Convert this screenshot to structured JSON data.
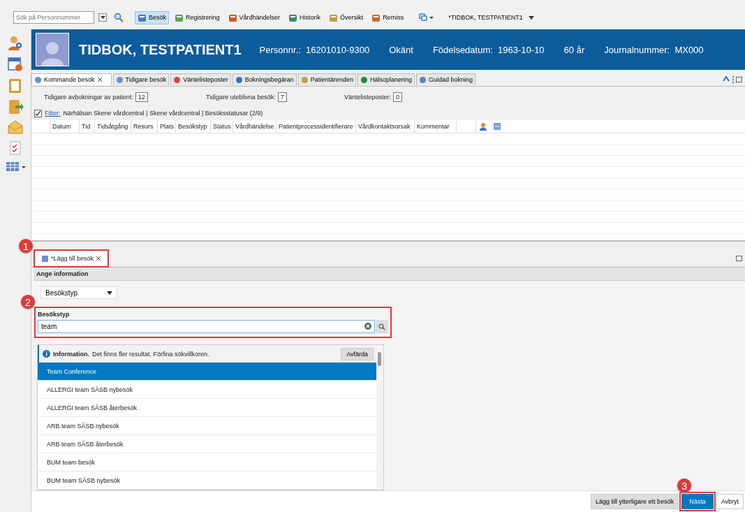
{
  "toolbar": {
    "search_placeholder": "Sök på Personnummer",
    "buttons": [
      {
        "label": "Besök",
        "selected": true
      },
      {
        "label": "Registrering",
        "selected": false
      },
      {
        "label": "Vårdhändelser",
        "selected": false
      },
      {
        "label": "Historik",
        "selected": false
      },
      {
        "label": "Översikt",
        "selected": false
      },
      {
        "label": "Remiss",
        "selected": false
      }
    ],
    "patient_menu": "*TIDBOK, TESTPATIENT1"
  },
  "header": {
    "name": "TIDBOK, TESTPATIENT1",
    "fields": [
      {
        "label": "Personnr.:",
        "value": "16201010-9300"
      },
      {
        "value": "Okänt"
      },
      {
        "label": "Födelsedatum:",
        "value": "1963-10-10"
      },
      {
        "value": "60 år"
      },
      {
        "label": "Journalnummer:",
        "value": "MX000"
      }
    ]
  },
  "tabs": [
    {
      "label": "Kommande besök",
      "selected": true
    },
    {
      "label": "Tidigare besök",
      "selected": false
    },
    {
      "label": "Väntelisteposter",
      "selected": false
    },
    {
      "label": "Bokningsbegäran",
      "selected": false
    },
    {
      "label": "Patientärenden",
      "selected": false
    },
    {
      "label": "Hälsoplanering",
      "selected": false
    },
    {
      "label": "Guidad bokning",
      "selected": false
    }
  ],
  "counters": [
    {
      "label": "Tidigare avbokningar av patient:",
      "value": "12"
    },
    {
      "label": "Tidigare uteblivna besök:",
      "value": "7"
    },
    {
      "label": "Väntelisteposter:",
      "value": "0"
    }
  ],
  "filter": {
    "checked": true,
    "link": "Filter:",
    "text": "Närhälsan Skene vårdcentral | Skene vårdcentral | Besöksstatusar (2/9)"
  },
  "table": {
    "columns": [
      "Datum",
      "Tid",
      "Tidsåtgång",
      "Resurs",
      "Plats",
      "Besökstyp",
      "Status",
      "Vårdhändelse",
      "Patientprocessidentifierare",
      "Vårdkontaktsorsak",
      "Kommentar"
    ]
  },
  "bottom_pane": {
    "tab": {
      "label": "*Lägg till besök",
      "callout": "1"
    },
    "section_title": "Ange information",
    "dropdown": "Besökstyp",
    "field": {
      "label": "Besökstyp",
      "value": "team",
      "callout": "2"
    },
    "info": {
      "title": "Information.",
      "text": "Det finns fler resultat. Förfina sökvillkoren.",
      "button": "Avfärda"
    },
    "results": [
      {
        "label": "Team Conference",
        "selected": true
      },
      {
        "label": "ALLERGI team SÄSB nybesök",
        "selected": false
      },
      {
        "label": "ALLERGI team SÄSB återbesök",
        "selected": false
      },
      {
        "label": "ARB team SÄSB nybesök",
        "selected": false
      },
      {
        "label": "ARB team SÄSB återbesök",
        "selected": false
      },
      {
        "label": "BUM team besök",
        "selected": false
      },
      {
        "label": "BUM team SÄSB nybesök",
        "selected": false
      }
    ],
    "buttons": [
      {
        "label": "Lägg till ytterligare ett besök",
        "kind": "secondary"
      },
      {
        "label": "Nästa",
        "kind": "primary",
        "callout": "3"
      },
      {
        "label": "Avbryt",
        "kind": "plain"
      }
    ]
  }
}
